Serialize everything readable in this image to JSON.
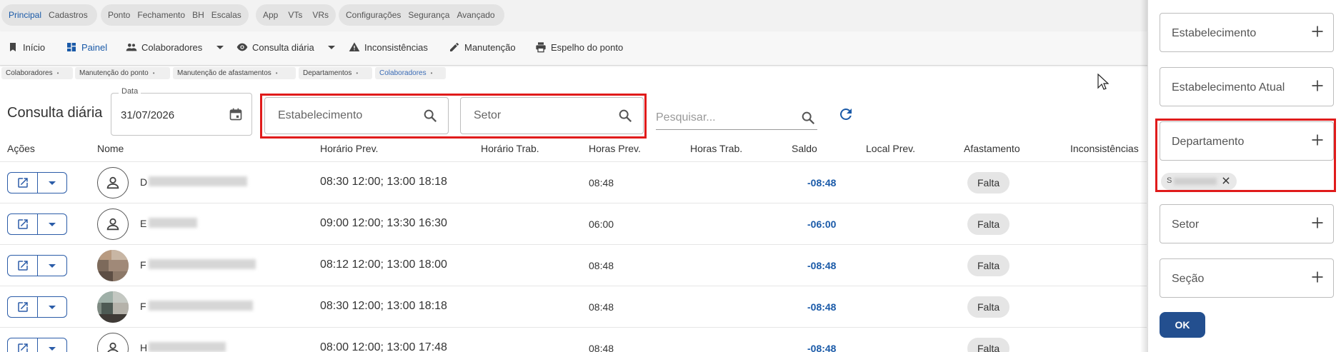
{
  "top_groups": [
    {
      "items": [
        "Principal",
        "Cadastros"
      ],
      "active": "Principal"
    },
    {
      "items": [
        "Ponto",
        "Fechamento",
        "BH",
        "Escalas"
      ]
    },
    {
      "items": [
        "App",
        "VTs",
        "VRs"
      ]
    },
    {
      "items": [
        "Configurações",
        "Segurança",
        "Avançado"
      ]
    }
  ],
  "menu": {
    "inicio": "Início",
    "painel": "Painel",
    "colaboradores": "Colaboradores",
    "consulta_diaria": "Consulta diária",
    "inconsistencias": "Inconsistências",
    "manutencao": "Manutenção",
    "espelho": "Espelho do ponto"
  },
  "breadcrumbs": [
    "Colaboradores",
    "Manutenção do ponto",
    "Manutenção de afastamentos",
    "Departamentos",
    "Colaboradores"
  ],
  "page": {
    "title": "Consulta diária",
    "date_label": "Data",
    "date_value": "31/07/2026",
    "estabelecimento_placeholder": "Estabelecimento",
    "setor_placeholder": "Setor",
    "search_placeholder": "Pesquisar..."
  },
  "table": {
    "headers": {
      "acoes": "Ações",
      "nome": "Nome",
      "horario_prev": "Horário Prev.",
      "horario_trab": "Horário Trab.",
      "horas_prev": "Horas Prev.",
      "horas_trab": "Horas Trab.",
      "saldo": "Saldo",
      "local_prev": "Local Prev.",
      "afastamento": "Afastamento",
      "inconsistencias": "Inconsistências"
    },
    "rows": [
      {
        "initial": "D",
        "horario_prev": "08:30 12:00; 13:00 18:18",
        "horas_prev": "08:48",
        "saldo": "-08:48",
        "afastamento": "Falta"
      },
      {
        "initial": "E",
        "horario_prev": "09:00 12:00; 13:30 16:30",
        "horas_prev": "06:00",
        "saldo": "-06:00",
        "afastamento": "Falta"
      },
      {
        "initial": "F",
        "horario_prev": "08:12 12:00; 13:00 18:00",
        "horas_prev": "08:48",
        "saldo": "-08:48",
        "afastamento": "Falta"
      },
      {
        "initial": "F",
        "horario_prev": "08:30 12:00; 13:00 18:18",
        "horas_prev": "08:48",
        "saldo": "-08:48",
        "afastamento": "Falta"
      },
      {
        "initial": "H",
        "horario_prev": "08:00 12:00; 13:00 17:48",
        "horas_prev": "08:48",
        "saldo": "-08:48",
        "afastamento": "Falta"
      }
    ]
  },
  "filter_panel": {
    "estabelecimento": "Estabelecimento",
    "estabelecimento_atual": "Estabelecimento Atual",
    "departamento": "Departamento",
    "departamento_chip": "S",
    "setor": "Setor",
    "secao": "Seção",
    "ok": "OK"
  },
  "colors": {
    "accent": "#1a5aa8",
    "highlight": "#e01b1b",
    "ok_button": "#234f8f"
  }
}
